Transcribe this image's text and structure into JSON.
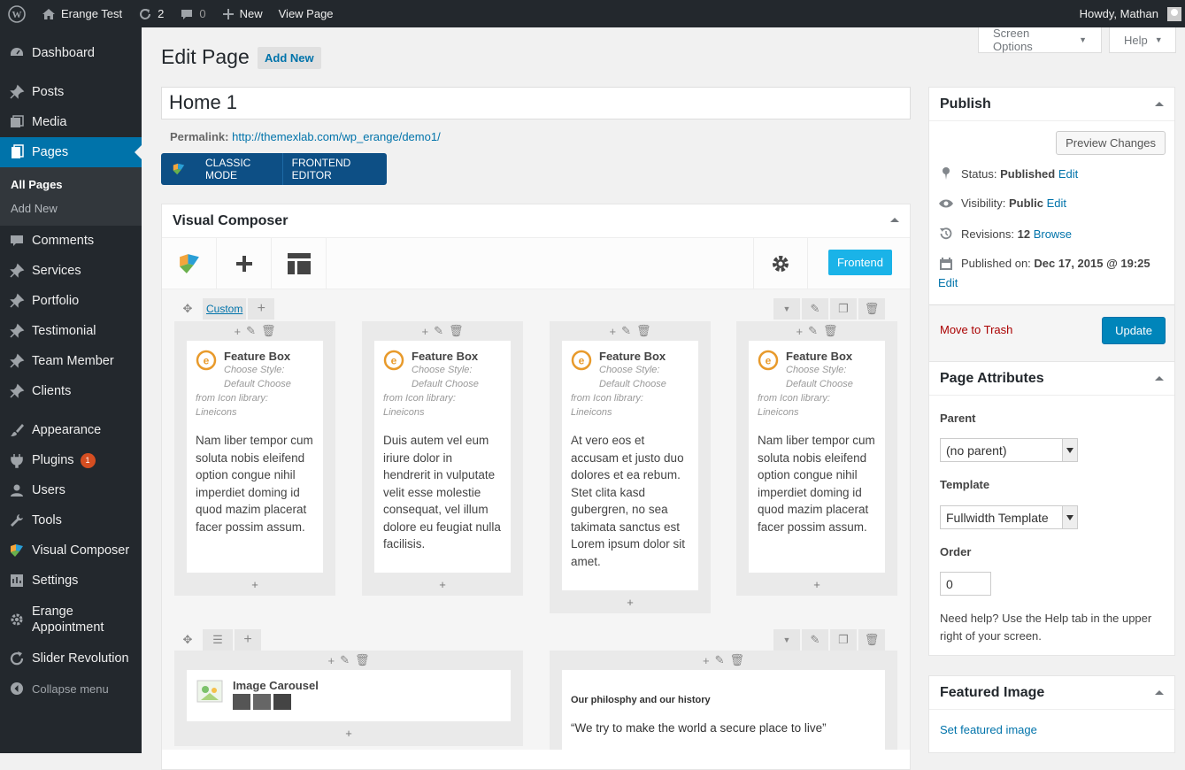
{
  "admin_bar": {
    "site_name": "Erange Test",
    "updates_count": "2",
    "comments_count": "0",
    "new_label": "New",
    "view_page_label": "View Page",
    "greeting": "Howdy, Mathan"
  },
  "sidebar": {
    "items": [
      {
        "label": "Dashboard",
        "icon": "dashboard-icon"
      },
      {
        "label": "Posts",
        "icon": "pin-icon"
      },
      {
        "label": "Media",
        "icon": "media-icon"
      },
      {
        "label": "Pages",
        "icon": "pages-icon"
      },
      {
        "label": "Comments",
        "icon": "comment-icon"
      },
      {
        "label": "Services",
        "icon": "pin-icon"
      },
      {
        "label": "Portfolio",
        "icon": "pin-icon"
      },
      {
        "label": "Testimonial",
        "icon": "pin-icon"
      },
      {
        "label": "Team Member",
        "icon": "pin-icon"
      },
      {
        "label": "Clients",
        "icon": "pin-icon"
      },
      {
        "label": "Appearance",
        "icon": "brush-icon"
      },
      {
        "label": "Plugins",
        "icon": "plugin-icon",
        "badge": "1"
      },
      {
        "label": "Users",
        "icon": "user-icon"
      },
      {
        "label": "Tools",
        "icon": "wrench-icon"
      },
      {
        "label": "Visual Composer",
        "icon": "vc-logo-icon"
      },
      {
        "label": "Settings",
        "icon": "settings-icon"
      },
      {
        "label": "Erange Appointment",
        "icon": "gear-icon"
      },
      {
        "label": "Slider Revolution",
        "icon": "refresh-icon"
      }
    ],
    "submenu": [
      "All Pages",
      "Add New"
    ],
    "collapse_label": "Collapse menu"
  },
  "header": {
    "title": "Edit Page",
    "add_new": "Add New",
    "screen_options": "Screen Options",
    "help": "Help"
  },
  "editor": {
    "page_title": "Home 1",
    "permalink_label": "Permalink:",
    "permalink_url": "http://themexlab.com/wp_erange/demo1/",
    "classic_mode": "CLASSIC MODE",
    "frontend_editor": "FRONTEND EDITOR"
  },
  "vc": {
    "title": "Visual Composer",
    "frontend_btn": "Frontend",
    "custom_label": "Custom",
    "feature_boxes": [
      {
        "title": "Feature Box",
        "meta1": "Choose Style:",
        "meta2": "Default  Choose",
        "meta3": "from Icon library:",
        "meta4": "Lineicons",
        "text": "Nam liber tempor cum soluta nobis eleifend option congue nihil imperdiet doming id quod mazim placerat facer possim assum."
      },
      {
        "title": "Feature Box",
        "meta1": "Choose Style:",
        "meta2": "Default  Choose",
        "meta3": "from Icon library:",
        "meta4": "Lineicons",
        "text": "Duis autem vel eum iriure dolor in hendrerit in vulputate velit esse molestie consequat, vel illum dolore eu feugiat nulla facilisis."
      },
      {
        "title": "Feature Box",
        "meta1": "Choose Style:",
        "meta2": "Default  Choose",
        "meta3": "from Icon library:",
        "meta4": "Lineicons",
        "text": "At vero eos et accusam et justo duo dolores et ea rebum. Stet clita kasd gubergren, no sea takimata sanctus est Lorem ipsum dolor sit amet."
      },
      {
        "title": "Feature Box",
        "meta1": "Choose Style:",
        "meta2": "Default  Choose",
        "meta3": "from Icon library:",
        "meta4": "Lineicons",
        "text": "Nam liber tempor cum soluta nobis eleifend option congue nihil imperdiet doming id quod mazim placerat facer possim assum."
      }
    ],
    "image_carousel": "Image Carousel",
    "philosophy_title": "Our philosphy and our history",
    "philosophy_quote": "“We try to make the world a secure place to live”"
  },
  "publish": {
    "title": "Publish",
    "preview": "Preview Changes",
    "status_label": "Status:",
    "status_value": "Published",
    "visibility_label": "Visibility:",
    "visibility_value": "Public",
    "revisions_label": "Revisions:",
    "revisions_value": "12",
    "browse": "Browse",
    "published_on_label": "Published on:",
    "published_on_value": "Dec 17, 2015 @ 19:25",
    "edit": "Edit",
    "trash": "Move to Trash",
    "update": "Update"
  },
  "attributes": {
    "title": "Page Attributes",
    "parent_label": "Parent",
    "parent_value": "(no parent)",
    "template_label": "Template",
    "template_value": "Fullwidth Template",
    "order_label": "Order",
    "order_value": "0",
    "help_text": "Need help? Use the Help tab in the upper right of your screen."
  },
  "featured": {
    "title": "Featured Image",
    "set_link": "Set featured image"
  },
  "colors": {
    "admin_dark": "#23282d",
    "accent_blue": "#0073aa",
    "vc_frontend": "#1ab3e8",
    "badge": "#d54e21"
  }
}
